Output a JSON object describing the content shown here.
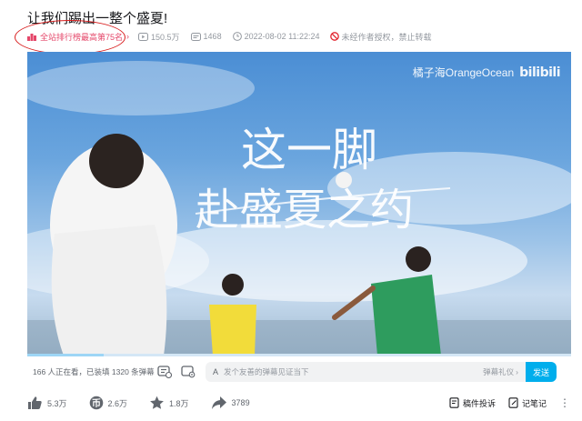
{
  "video": {
    "title": "让我们踢出一整个盛夏!",
    "rank_badge": "全站排行榜最高第75名",
    "views": "150.5万",
    "danmaku_count": "1468",
    "publish_time": "2022-08-02 11:22:24",
    "copyright_notice": "未经作者授权，禁止转载"
  },
  "player": {
    "watermark_name": "橘子海OrangeOcean",
    "watermark_logo": "bilibili",
    "calligraphy_line1": "这一脚",
    "calligraphy_line2": "赴盛夏之约",
    "progress_fraction": 0.14
  },
  "danmaku": {
    "viewers_text": "166 人正在看，已装填 1320 条弹幕",
    "input_placeholder": "发个友善的弹幕见证当下",
    "etiquette_label": "弹幕礼仪",
    "send_label": "发送"
  },
  "toolbar": {
    "like_count": "5.3万",
    "coin_count": "2.6万",
    "favorite_count": "1.8万",
    "share_count": "3789",
    "report_label": "稿件投诉",
    "notes_label": "记笔记"
  },
  "colors": {
    "accent": "#00aeec",
    "rank_pink": "#e5476a",
    "annotation_red": "#d81e1e",
    "icon_gray": "#61666d"
  }
}
